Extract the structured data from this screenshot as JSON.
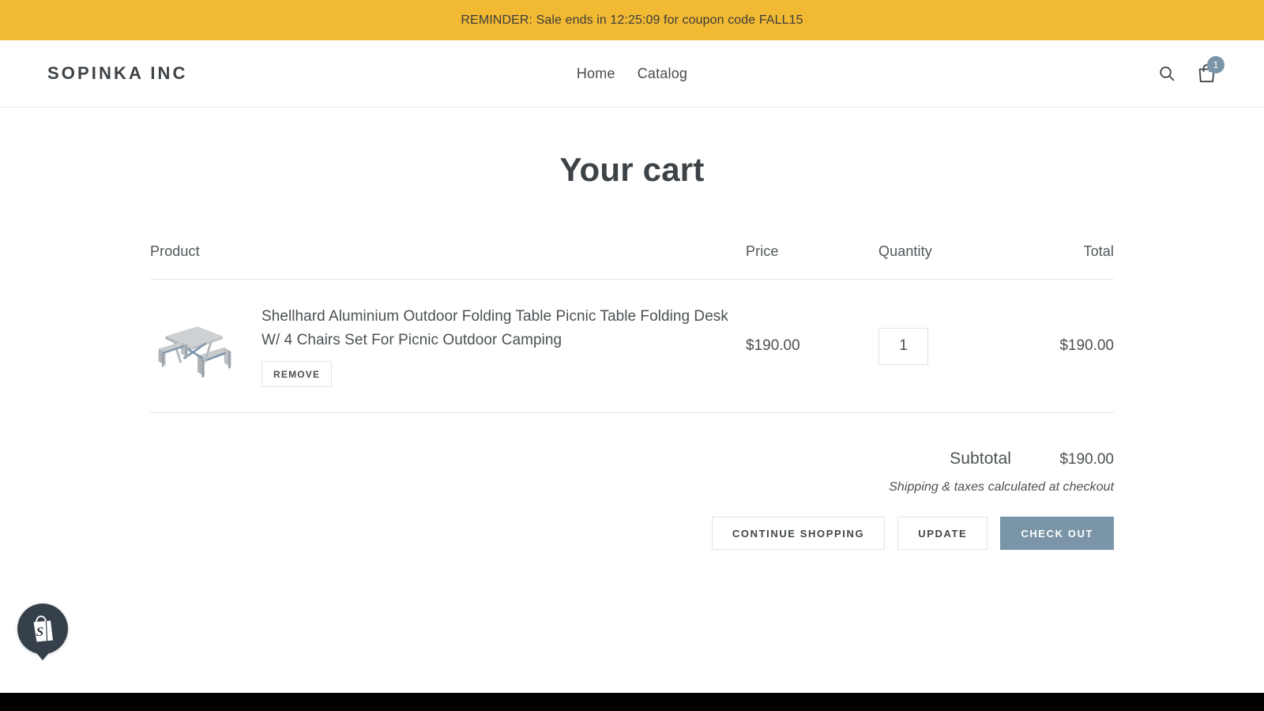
{
  "announcement": {
    "text": "REMINDER: Sale ends in 12:25:09 for coupon code FALL15",
    "background_color": "#f2b933",
    "countdown": "12:25:09",
    "coupon_code": "FALL15"
  },
  "header": {
    "brand": "SOPINKA INC",
    "nav": [
      {
        "label": "Home"
      },
      {
        "label": "Catalog"
      }
    ],
    "search_icon": "search-icon",
    "cart_icon": "shopping-bag-icon",
    "cart_count": "1",
    "cart_badge_color": "#7a95a7"
  },
  "page": {
    "title": "Your cart"
  },
  "cart": {
    "columns": {
      "product": "Product",
      "price": "Price",
      "quantity": "Quantity",
      "total": "Total"
    },
    "items": [
      {
        "title": "Shellhard Aluminium Outdoor Folding Table Picnic Table Folding Desk W/ 4 Chairs Set For Picnic Outdoor Camping",
        "image_alt": "aluminium folding picnic table with four attached chairs",
        "remove_label": "REMOVE",
        "price": "$190.00",
        "quantity": "1",
        "total": "$190.00"
      }
    ],
    "subtotal_label": "Subtotal",
    "subtotal_value": "$190.00",
    "shipping_note": "Shipping & taxes calculated at checkout",
    "actions": {
      "continue_shopping": "CONTINUE SHOPPING",
      "update": "UPDATE",
      "checkout": "CHECK OUT",
      "checkout_color": "#7a95a7"
    }
  },
  "chat_widget": {
    "icon": "shopify-bag-icon",
    "background_color": "#36404a"
  }
}
